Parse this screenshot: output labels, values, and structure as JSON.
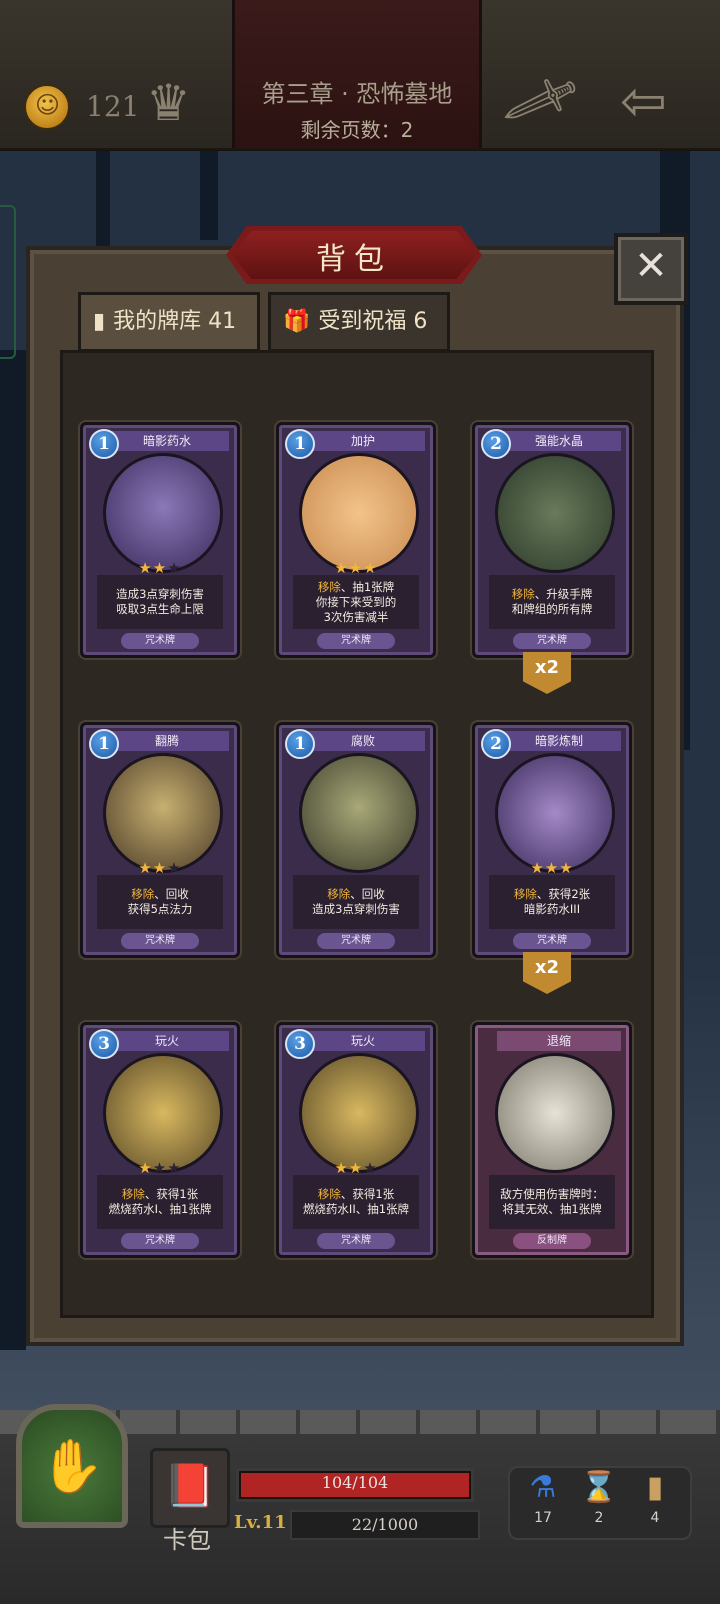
{
  "header": {
    "gold": "121",
    "chapter_title": "第三章 · 恐怖墓地",
    "pages_left": "剩余页数：2",
    "icons": [
      "coin-icon",
      "crown-icon",
      "sword-icon",
      "back-arrow-icon"
    ]
  },
  "dialog": {
    "title": "背包",
    "close_icon": "close-icon",
    "tabs": [
      {
        "label": "我的牌库 41",
        "icon": "cards-icon"
      },
      {
        "label": "受到祝福 6",
        "icon": "gift-icon"
      }
    ]
  },
  "cards": [
    {
      "cost": "1",
      "name": "暗影药水",
      "stars": 2,
      "desc_kw": "",
      "desc": "造成3点穿刺伤害",
      "desc2": "吸取3点生命上限",
      "type": "咒术牌",
      "multiplier": ""
    },
    {
      "cost": "1",
      "name": "加护",
      "stars": 3,
      "desc_kw": "移除",
      "desc": "、抽1张牌",
      "desc2": "你接下来受到的",
      "desc3": "3次伤害减半",
      "type": "咒术牌",
      "multiplier": ""
    },
    {
      "cost": "2",
      "name": "强能水晶",
      "stars": 0,
      "desc_kw": "移除",
      "desc": "、升级手牌",
      "desc2": "和牌组的所有牌",
      "type": "咒术牌",
      "multiplier": "x2"
    },
    {
      "cost": "1",
      "name": "翻腾",
      "stars": 2,
      "desc_kw": "移除",
      "desc": "、回收",
      "desc2": "获得5点法力",
      "type": "咒术牌",
      "multiplier": ""
    },
    {
      "cost": "1",
      "name": "腐败",
      "stars": 0,
      "desc_kw": "移除",
      "desc": "、回收",
      "desc2": "造成3点穿刺伤害",
      "type": "咒术牌",
      "multiplier": ""
    },
    {
      "cost": "2",
      "name": "暗影炼制",
      "stars": 3,
      "desc_kw": "移除",
      "desc": "、获得2张",
      "desc2": "暗影药水III",
      "type": "咒术牌",
      "multiplier": "x2"
    },
    {
      "cost": "3",
      "name": "玩火",
      "stars": 1,
      "desc_kw": "移除",
      "desc": "、获得1张",
      "desc2": "燃烧药水I、抽1张牌",
      "type": "咒术牌",
      "multiplier": ""
    },
    {
      "cost": "3",
      "name": "玩火",
      "stars": 2,
      "desc_kw": "移除",
      "desc": "、获得1张",
      "desc2": "燃烧药水II、抽1张牌",
      "type": "咒术牌",
      "multiplier": ""
    },
    {
      "cost": "",
      "name": "退缩",
      "stars": 0,
      "desc_kw": "",
      "desc": "敌方使用伤害牌时：",
      "desc2": "将其无效、抽1张牌",
      "type": "反制牌",
      "multiplier": ""
    }
  ],
  "hud": {
    "deck_label": "卡包",
    "hp": "104/104",
    "hp_fraction": 1.0,
    "level": "Lv.11",
    "xp": "22/1000",
    "resources": [
      {
        "icon": "potion-icon",
        "value": "17"
      },
      {
        "icon": "hourglass-icon",
        "value": "2"
      },
      {
        "icon": "cards-icon",
        "value": "4"
      }
    ]
  },
  "colors": {
    "accent_red": "#8e2020",
    "gold": "#f2b63a",
    "card_purple": "#5d4685",
    "cost_blue": "#1c5aa8"
  }
}
